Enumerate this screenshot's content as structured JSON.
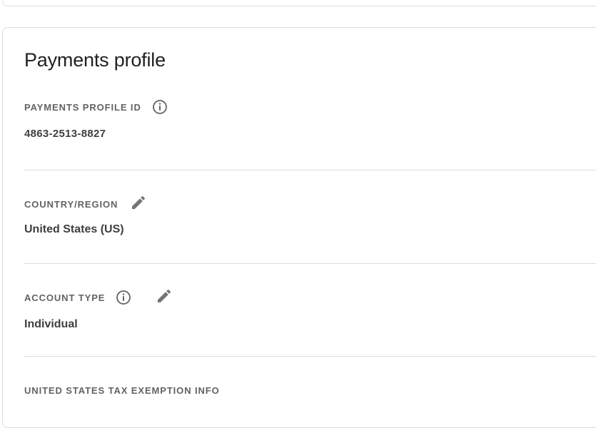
{
  "card": {
    "title": "Payments profile"
  },
  "fields": {
    "profile_id": {
      "label": "PAYMENTS PROFILE ID",
      "value": "4863-2513-8827",
      "info_icon": "info-icon"
    },
    "country": {
      "label": "COUNTRY/REGION",
      "value": "United States (US)",
      "edit_icon": "edit-pencil-icon"
    },
    "account_type": {
      "label": "ACCOUNT TYPE",
      "value": "Individual",
      "info_icon": "info-icon",
      "edit_icon": "edit-pencil-icon"
    },
    "tax_exemption": {
      "label": "UNITED STATES TAX EXEMPTION INFO"
    }
  },
  "colors": {
    "label": "#5f6368",
    "value": "#3c4043",
    "icon": "#757575",
    "divider": "#dadce0"
  }
}
